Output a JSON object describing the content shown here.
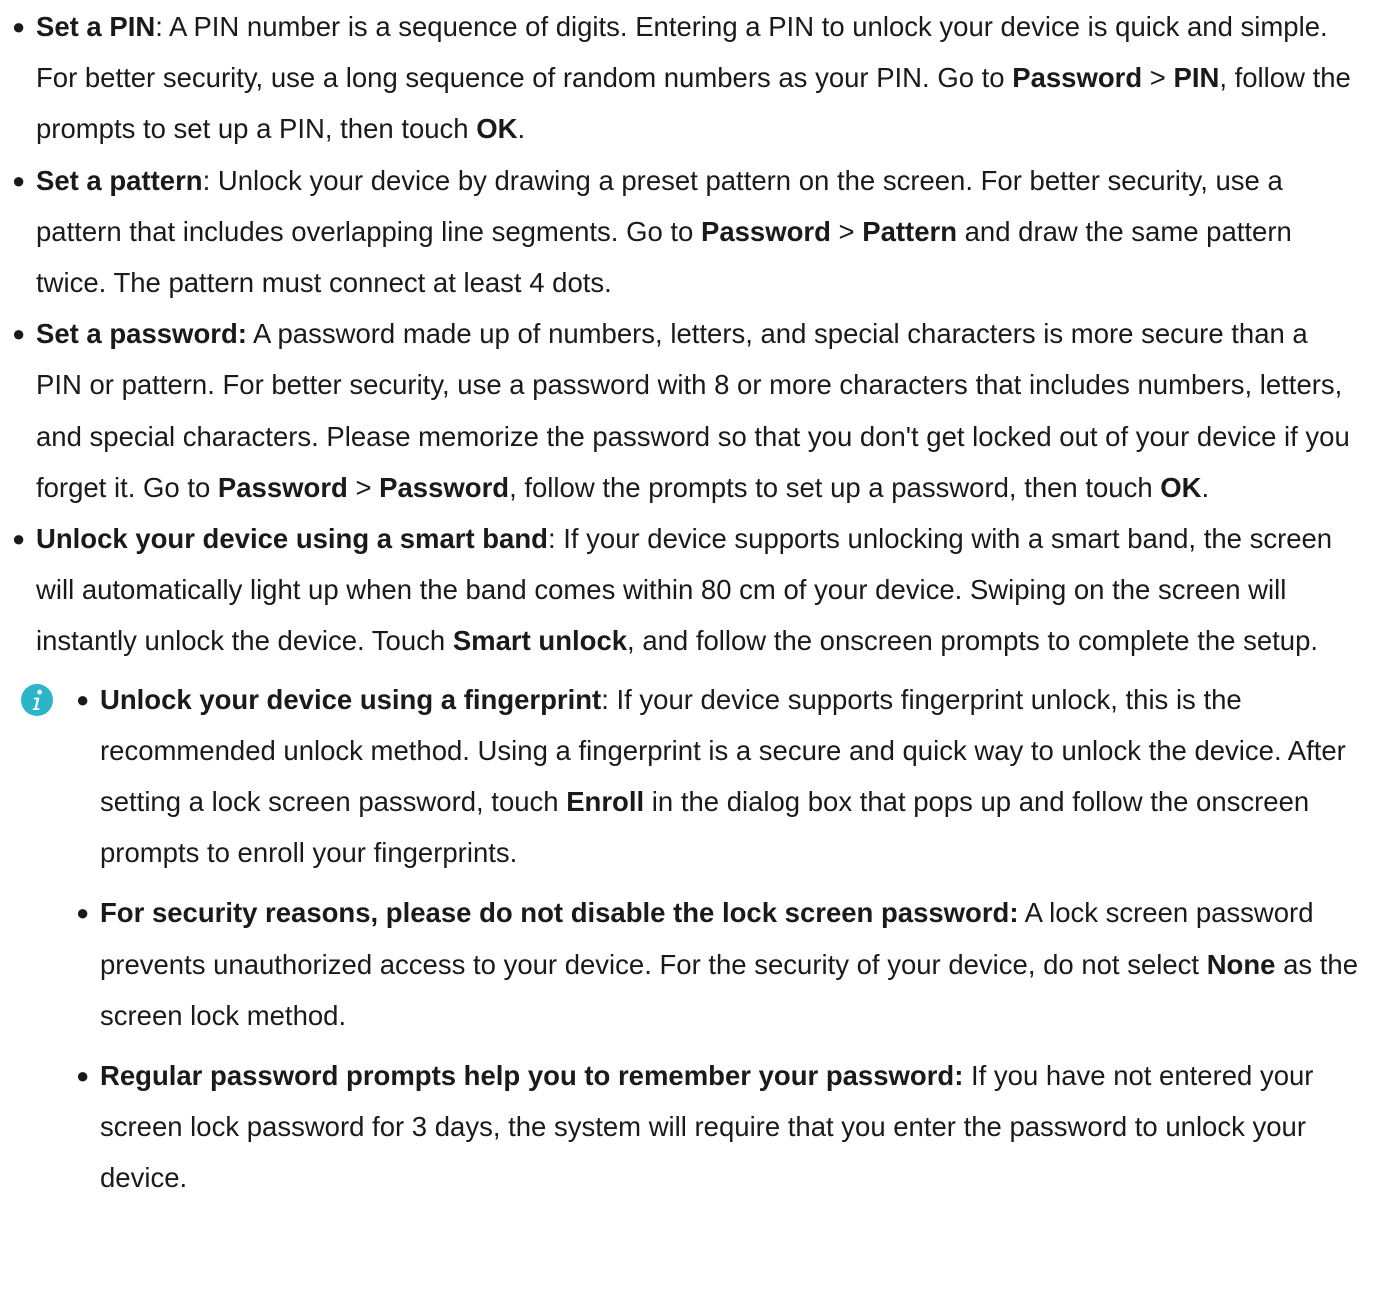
{
  "items": [
    {
      "parts": [
        {
          "b": "Set a PIN"
        },
        {
          "t": ": A PIN number is a sequence of digits. Entering a PIN to unlock your device is quick and simple. For better security, use a long sequence of random numbers as your PIN. Go to "
        },
        {
          "b": "Password"
        },
        {
          "t": " > "
        },
        {
          "b": "PIN"
        },
        {
          "t": ", follow the prompts to set up a PIN, then touch "
        },
        {
          "b": "OK"
        },
        {
          "t": "."
        }
      ]
    },
    {
      "parts": [
        {
          "b": "Set a pattern"
        },
        {
          "t": ": Unlock your device by drawing a preset pattern on the screen. For better security, use a pattern that includes overlapping line segments. Go to "
        },
        {
          "b": "Password"
        },
        {
          "t": " > "
        },
        {
          "b": "Pattern"
        },
        {
          "t": " and draw the same pattern twice. The pattern must connect at least 4 dots."
        }
      ]
    },
    {
      "parts": [
        {
          "b": "Set a password:"
        },
        {
          "t": " A password made up of numbers, letters, and special characters is more secure than a PIN or pattern. For better security, use a password with 8 or more characters that includes numbers, letters, and special characters. Please memorize the password so that you don't get locked out of your device if you forget it. Go to "
        },
        {
          "b": "Password"
        },
        {
          "t": " > "
        },
        {
          "b": "Password"
        },
        {
          "t": ", follow the prompts to set up a password, then touch "
        },
        {
          "b": "OK"
        },
        {
          "t": "."
        }
      ]
    },
    {
      "parts": [
        {
          "b": "Unlock your device using a smart band"
        },
        {
          "t": ": If your device supports unlocking with a smart band, the screen will automatically light up when the band comes within 80 cm of your device. Swiping on the screen will instantly unlock the device. Touch "
        },
        {
          "b": "Smart unlock"
        },
        {
          "t": ", and follow the onscreen prompts to complete the setup."
        }
      ]
    }
  ],
  "notes": [
    {
      "parts": [
        {
          "b": "Unlock your device using a fingerprint"
        },
        {
          "t": ": If your device supports fingerprint unlock, this is the recommended unlock method. Using a fingerprint is a secure and quick way to unlock the device. After setting a lock screen password, touch "
        },
        {
          "b": "Enroll"
        },
        {
          "t": " in the dialog box that pops up and follow the onscreen prompts to enroll your fingerprints."
        }
      ]
    },
    {
      "parts": [
        {
          "b": "For security reasons, please do not disable the lock screen password:"
        },
        {
          "t": " A lock screen password prevents unauthorized access to your device. For the security of your device, do not select "
        },
        {
          "b": "None"
        },
        {
          "t": " as the screen lock method."
        }
      ]
    },
    {
      "parts": [
        {
          "b": "Regular password prompts help you to remember your password:"
        },
        {
          "t": " If you have not entered your screen lock password for 3 days, the system will require that you enter the password to unlock your device."
        }
      ]
    }
  ],
  "bullet_glyph": "●",
  "icons": {
    "info": "info-icon",
    "info_color": "#2cb5c9"
  }
}
